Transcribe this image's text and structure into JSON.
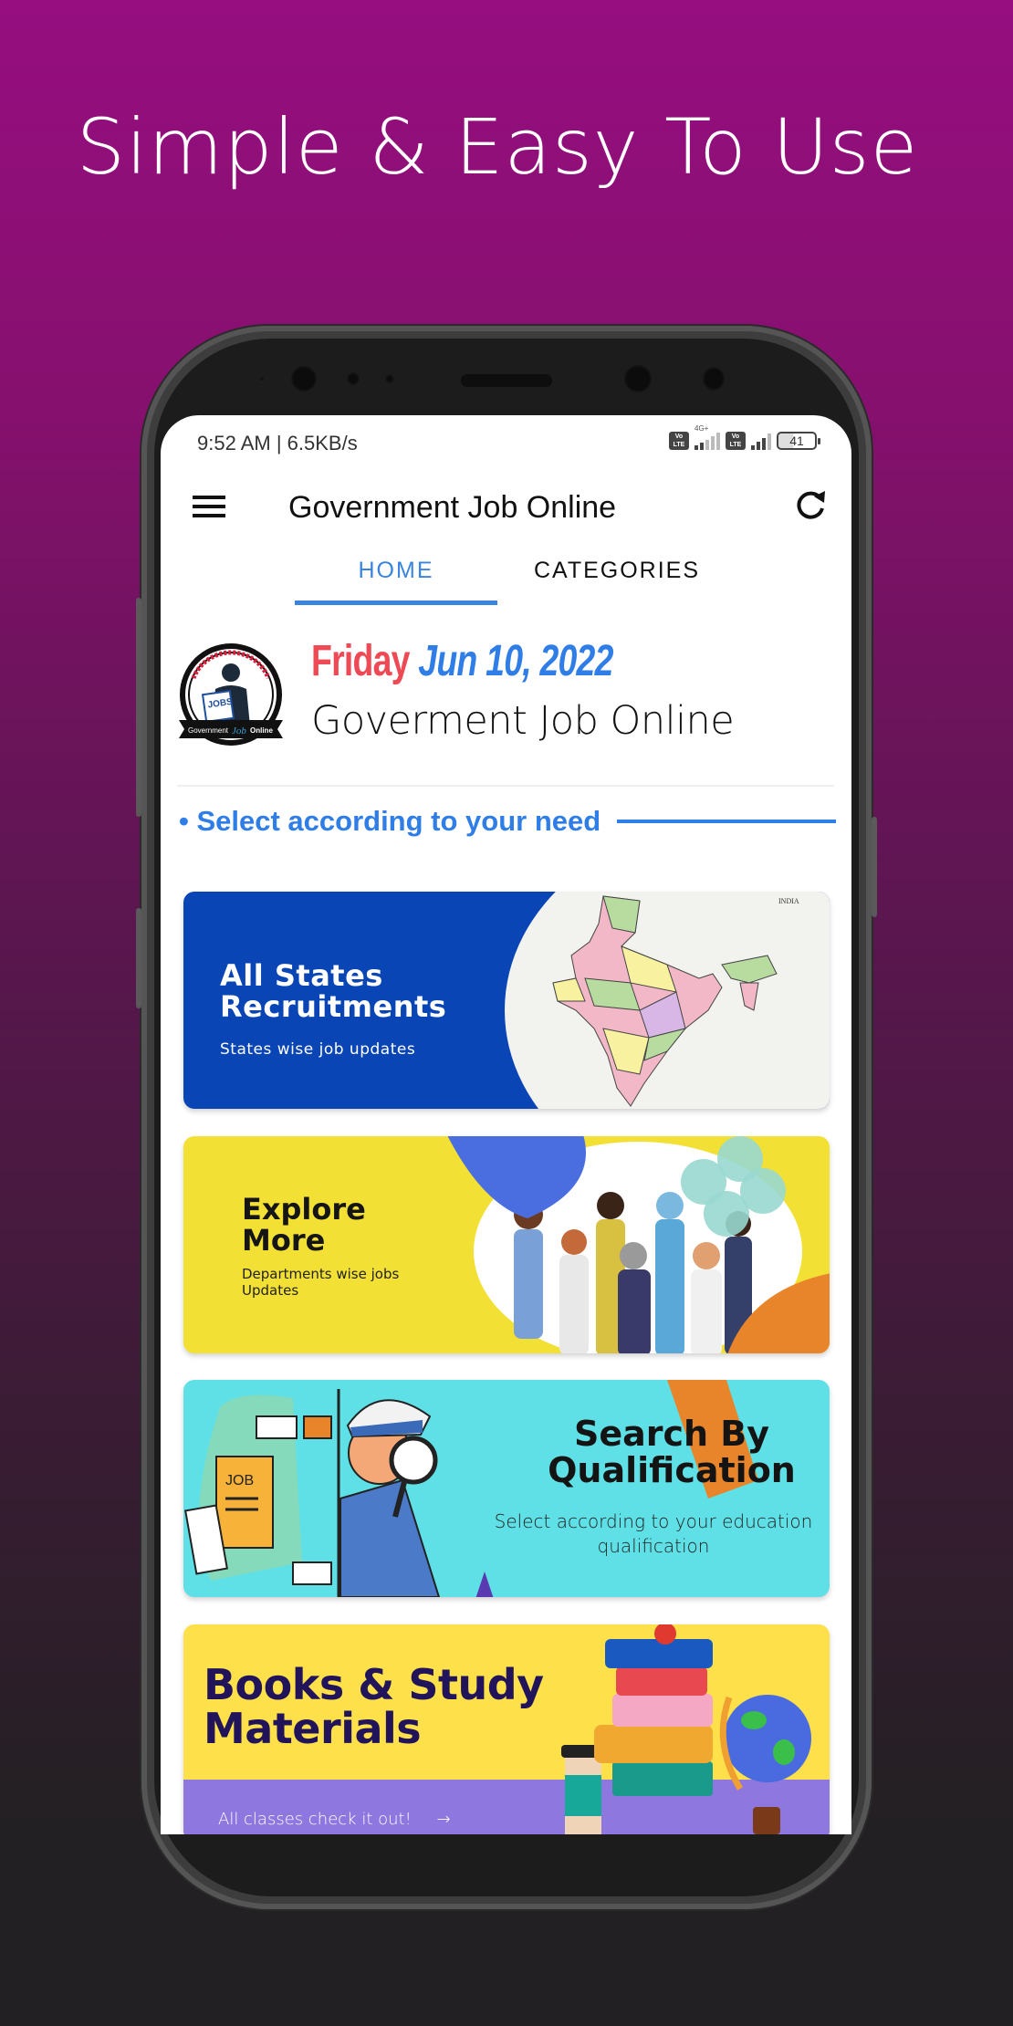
{
  "promo": {
    "headline": "Simple & Easy To Use"
  },
  "colors": {
    "accent_blue": "#2f7de6",
    "day_red": "#ee4a55",
    "banner1_bg": "#0a45b5",
    "banner2_bg": "#f3e035",
    "banner3_bg": "#5fe0e6",
    "banner4_bg": "#fde04a",
    "banner4_band": "#8f77e0"
  },
  "status_bar": {
    "time_speed": "9:52 AM | 6.5KB/s",
    "sim1_badge": "Vo LTE",
    "sim1_network": "4G+",
    "sim2_badge": "Vo LTE",
    "battery_level": "41"
  },
  "app_bar": {
    "menu_icon": "hamburger-menu-icon",
    "title": "Government Job Online",
    "refresh_icon": "refresh-icon"
  },
  "tabs": [
    {
      "label": "HOME",
      "active": true
    },
    {
      "label": "CATEGORIES",
      "active": false
    }
  ],
  "header": {
    "logo_text_top": "ABILITY IS NOTHING WITHOUT OPPORTUNITY",
    "logo_text_center": "JOBS",
    "logo_ribbon": "Government Job Online",
    "day": "Friday",
    "date": "Jun 10, 2022",
    "brand_name": "Goverment Job Online"
  },
  "section": {
    "label": "• Select according to your need"
  },
  "banners": [
    {
      "title_line1": "All States",
      "title_line2": "Recruitments",
      "subtitle": "States wise job updates",
      "image_label": "INDIA"
    },
    {
      "title_line1": "Explore",
      "title_line2": "More",
      "subtitle_line1": "Departments wise jobs",
      "subtitle_line2": "Updates"
    },
    {
      "title_line1": "Search By",
      "title_line2": "Qualification",
      "subtitle_line1": "Select according to your education",
      "subtitle_line2": "qualification",
      "image_label": "JOB"
    },
    {
      "title_line1": "Books & Study",
      "title_line2": "Materials",
      "subtitle": "All classes check it out!",
      "arrow": "→"
    }
  ]
}
